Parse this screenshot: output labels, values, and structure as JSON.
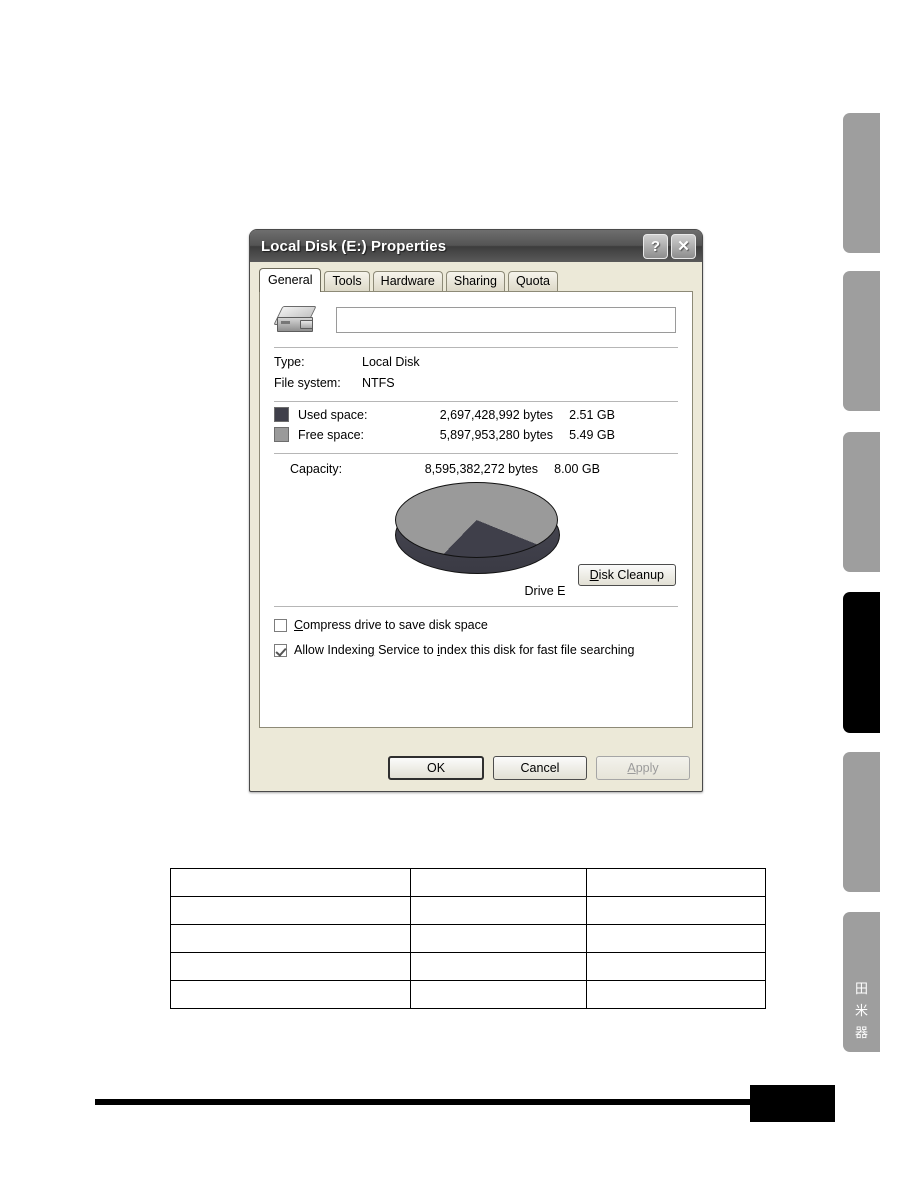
{
  "dialog": {
    "title": "Local Disk (E:) Properties",
    "help_button": "?",
    "close_button": "✕",
    "tabs": [
      {
        "label": "General",
        "active": true
      },
      {
        "label": "Tools",
        "active": false
      },
      {
        "label": "Hardware",
        "active": false
      },
      {
        "label": "Sharing",
        "active": false
      },
      {
        "label": "Quota",
        "active": false
      }
    ],
    "general": {
      "volume_label_value": "",
      "volume_label_placeholder": "",
      "disk_icon": "hard-disk-icon",
      "type_label": "Type:",
      "type_value": "Local Disk",
      "filesystem_label": "File system:",
      "filesystem_value": "NTFS",
      "used_space_label": "Used space:",
      "used_space_bytes": "2,697,428,992 bytes",
      "used_space_gb": "2.51 GB",
      "free_space_label": "Free space:",
      "free_space_bytes": "5,897,953,280 bytes",
      "free_space_gb": "5.49 GB",
      "capacity_label": "Capacity:",
      "capacity_bytes": "8,595,382,272 bytes",
      "capacity_gb": "8.00 GB",
      "drive_caption": "Drive E",
      "disk_cleanup_button": "Disk Cleanup",
      "compress_checkbox_label": "Compress drive to save disk space",
      "compress_checked": false,
      "index_checkbox_label": "Allow Indexing Service to index this disk for fast file searching",
      "index_checked": true
    },
    "footer": {
      "ok_label": "OK",
      "cancel_label": "Cancel",
      "apply_label": "Apply",
      "apply_disabled": true
    },
    "colors": {
      "used_swatch": "#3f3f4a",
      "free_swatch": "#9a9a9a",
      "titlebar": "#545454",
      "dialog_face": "#ece9d8"
    }
  },
  "chart_data": {
    "type": "pie",
    "title": "Drive E",
    "categories": [
      "Used space",
      "Free space"
    ],
    "values": [
      2697428992,
      5897953280
    ],
    "value_unit": "bytes",
    "percentages": [
      31.4,
      68.6
    ],
    "colors": [
      "#3f3f4a",
      "#9a9a9a"
    ],
    "legend": "swatches in list above",
    "total": 8595382272
  },
  "side_tabs": [
    {
      "index": 1,
      "active": false,
      "glyphs": []
    },
    {
      "index": 2,
      "active": false,
      "glyphs": []
    },
    {
      "index": 3,
      "active": false,
      "glyphs": []
    },
    {
      "index": 4,
      "active": true,
      "glyphs": []
    },
    {
      "index": 5,
      "active": false,
      "glyphs": []
    },
    {
      "index": 6,
      "active": false,
      "glyphs": [
        "田",
        "米",
        "器"
      ]
    }
  ],
  "doc_table": {
    "rows": [
      [
        "",
        "",
        ""
      ],
      [
        "",
        "",
        ""
      ],
      [
        "",
        "",
        ""
      ],
      [
        "",
        "",
        ""
      ],
      [
        "",
        "",
        ""
      ]
    ]
  },
  "page_footer": {
    "page_number_box": ""
  }
}
